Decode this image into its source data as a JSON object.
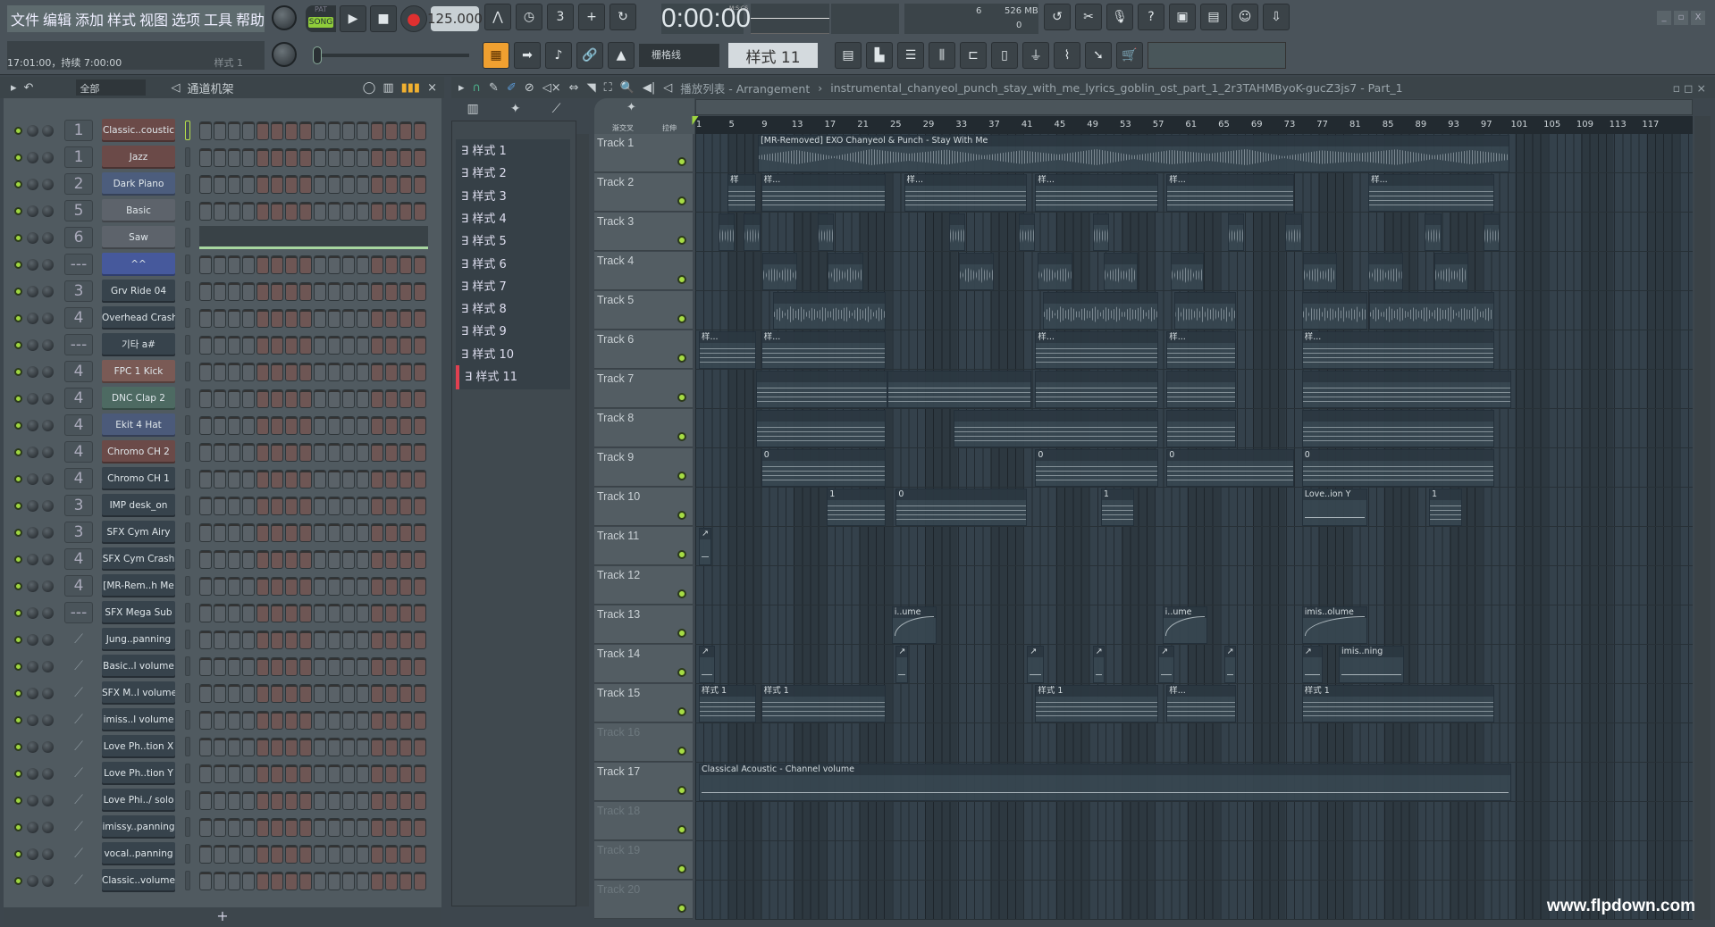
{
  "menu": [
    "文件",
    "编辑",
    "添加",
    "样式",
    "视图",
    "选项",
    "工具",
    "帮助"
  ],
  "hint": {
    "text": "17:01:00，持续 7:00:00",
    "pattern": "样式 1"
  },
  "transport": {
    "pat": "PAT",
    "song": "SONG",
    "tempo": "125.000",
    "time": "0:00:00",
    "time_unit": "M:S:CS",
    "cpu": "6",
    "memory": "526 MB",
    "poly": "0",
    "snap": "栅格线",
    "pattern": "样式 11"
  },
  "colors": {
    "accent": "#f0a030",
    "led": "#a6dc44",
    "record": "#e03030"
  },
  "channel_rack": {
    "filter": "全部",
    "title": "通道机架",
    "add": "+",
    "channels": [
      {
        "name": "Classic..coustic",
        "mixer": "1",
        "color": "#6b4a48"
      },
      {
        "name": "Jazz",
        "mixer": "1",
        "color": "#6b4a48"
      },
      {
        "name": "Dark Piano",
        "mixer": "2",
        "color": "#4c5d7d"
      },
      {
        "name": "Basic",
        "mixer": "5",
        "color": "#5d636b"
      },
      {
        "name": "Saw",
        "mixer": "6",
        "color": "#5d636b",
        "preview": true
      },
      {
        "name": "^^",
        "mixer": "---",
        "color": "#46599c"
      },
      {
        "name": "Grv Ride 04",
        "mixer": "3",
        "color": "#37434c"
      },
      {
        "name": "Overhead Crash",
        "mixer": "4",
        "color": "#37434c"
      },
      {
        "name": "기타 a#",
        "mixer": "---",
        "color": "#37434c"
      },
      {
        "name": "FPC 1 Kick",
        "mixer": "4",
        "color": "#7a5a55"
      },
      {
        "name": "DNC Clap 2",
        "mixer": "4",
        "color": "#4d6a62"
      },
      {
        "name": "Ekit 4 Hat",
        "mixer": "4",
        "color": "#4b5a7a"
      },
      {
        "name": "Chromo CH 2",
        "mixer": "4",
        "color": "#6b4a48"
      },
      {
        "name": "Chromo CH 1",
        "mixer": "4",
        "color": "#37434c"
      },
      {
        "name": "IMP desk_on",
        "mixer": "3",
        "color": "#37434c"
      },
      {
        "name": "SFX Cym Airy",
        "mixer": "3",
        "color": "#37434c"
      },
      {
        "name": "SFX Cym Crash",
        "mixer": "4",
        "color": "#37434c"
      },
      {
        "name": "[MR-Rem..h Me",
        "mixer": "4",
        "color": "#37434c"
      },
      {
        "name": "SFX Mega Sub",
        "mixer": "---",
        "color": "#37434c"
      },
      {
        "name": "Jung..panning",
        "mixer": "",
        "color": "#37434c",
        "auto": true
      },
      {
        "name": "Basic..l volume",
        "mixer": "",
        "color": "#37434c",
        "auto": true
      },
      {
        "name": "SFX M..l volume",
        "mixer": "",
        "color": "#37434c",
        "auto": true
      },
      {
        "name": "imiss..l volume",
        "mixer": "",
        "color": "#37434c",
        "auto": true
      },
      {
        "name": "Love Ph..tion X",
        "mixer": "",
        "color": "#37434c",
        "auto": true
      },
      {
        "name": "Love Ph..tion Y",
        "mixer": "",
        "color": "#37434c",
        "auto": true
      },
      {
        "name": "Love Phi../ solo",
        "mixer": "",
        "color": "#37434c",
        "auto": true
      },
      {
        "name": "imissy..panning",
        "mixer": "",
        "color": "#37434c",
        "auto": true
      },
      {
        "name": "vocal..panning",
        "mixer": "",
        "color": "#37434c",
        "auto": true
      },
      {
        "name": "Classic..volume",
        "mixer": "",
        "color": "#37434c",
        "auto": true
      }
    ]
  },
  "patterns": [
    "样式 1",
    "样式 2",
    "样式 3",
    "样式 4",
    "样式 5",
    "样式 6",
    "样式 7",
    "样式 8",
    "样式 9",
    "样式 10",
    "样式 11"
  ],
  "selected_pattern": "样式 11",
  "playlist": {
    "title": "播放列表 - Arrangement",
    "project": "instrumental_chanyeol_punch_stay_with_me_lyrics_goblin_ost_part_1_2r3TAHMByoK-gucZ3js7 - Part_1",
    "crossfade": "渐交叉",
    "stretch": "拉伸",
    "ruler": [
      1,
      5,
      9,
      13,
      17,
      21,
      25,
      29,
      33,
      37,
      41,
      45,
      49,
      53,
      57,
      61,
      65,
      69,
      73,
      77,
      81,
      85,
      89,
      93,
      97,
      101,
      105,
      109,
      113,
      117
    ],
    "tracks": [
      {
        "name": "Track 1",
        "clips": [
          {
            "type": "audio",
            "start": 8.2,
            "end": 99.8,
            "label": "[MR-Removed] EXO Chanyeol & Punch - Stay With Me"
          }
        ]
      },
      {
        "name": "Track 2",
        "clips": [
          {
            "type": "pattern",
            "start": 4.5,
            "end": 8,
            "label": "样"
          },
          {
            "type": "pattern",
            "start": 8.6,
            "end": 23.8,
            "label": "样..."
          },
          {
            "type": "pattern",
            "start": 26,
            "end": 41,
            "label": "样..."
          },
          {
            "type": "pattern",
            "start": 42,
            "end": 57,
            "label": "样..."
          },
          {
            "type": "pattern",
            "start": 58,
            "end": 73.5,
            "label": "样..."
          },
          {
            "type": "pattern",
            "start": 82.6,
            "end": 98,
            "label": "样..."
          }
        ]
      },
      {
        "name": "Track 3",
        "clips": [
          {
            "type": "audio",
            "start": 3.4,
            "end": 5.4,
            "label": ""
          },
          {
            "type": "audio",
            "start": 6.5,
            "end": 8.5,
            "label": ""
          },
          {
            "type": "audio",
            "start": 15.5,
            "end": 17.5,
            "label": ""
          },
          {
            "type": "audio",
            "start": 31.5,
            "end": 33.5,
            "label": ""
          },
          {
            "type": "audio",
            "start": 40,
            "end": 42,
            "label": ""
          },
          {
            "type": "audio",
            "start": 49,
            "end": 51,
            "label": ""
          },
          {
            "type": "audio",
            "start": 65.5,
            "end": 67.5,
            "label": ""
          },
          {
            "type": "audio",
            "start": 72.5,
            "end": 74.5,
            "label": ""
          },
          {
            "type": "audio",
            "start": 89.5,
            "end": 91.5,
            "label": ""
          },
          {
            "type": "audio",
            "start": 96.6,
            "end": 98.6,
            "label": ""
          }
        ]
      },
      {
        "name": "Track 4",
        "clips": [
          {
            "type": "audio",
            "start": 8.7,
            "end": 13,
            "label": ""
          },
          {
            "type": "audio",
            "start": 16.7,
            "end": 21,
            "label": ""
          },
          {
            "type": "audio",
            "start": 32.7,
            "end": 37,
            "label": ""
          },
          {
            "type": "audio",
            "start": 42.3,
            "end": 46.5,
            "label": ""
          },
          {
            "type": "audio",
            "start": 50.3,
            "end": 54.5,
            "label": ""
          },
          {
            "type": "audio",
            "start": 58.5,
            "end": 62.5,
            "label": ""
          },
          {
            "type": "audio",
            "start": 74.6,
            "end": 78.8,
            "label": ""
          },
          {
            "type": "audio",
            "start": 82.6,
            "end": 86.8,
            "label": ""
          },
          {
            "type": "audio",
            "start": 90.6,
            "end": 94.8,
            "label": ""
          }
        ]
      },
      {
        "name": "Track 5",
        "clips": [
          {
            "type": "audio",
            "start": 10,
            "end": 23.8,
            "label": ""
          },
          {
            "type": "audio",
            "start": 42.9,
            "end": 57,
            "label": ""
          },
          {
            "type": "audio",
            "start": 59,
            "end": 66.5,
            "label": ""
          },
          {
            "type": "audio",
            "start": 74.5,
            "end": 82.5,
            "label": ""
          },
          {
            "type": "audio",
            "start": 82.7,
            "end": 98,
            "label": ""
          }
        ]
      },
      {
        "name": "Track 6",
        "clips": [
          {
            "type": "pattern",
            "start": 1,
            "end": 8,
            "label": "样..."
          },
          {
            "type": "pattern",
            "start": 8.6,
            "end": 23.8,
            "label": "样..."
          },
          {
            "type": "pattern",
            "start": 42,
            "end": 57,
            "label": "样..."
          },
          {
            "type": "pattern",
            "start": 58,
            "end": 66.5,
            "label": "样..."
          },
          {
            "type": "pattern",
            "start": 74.5,
            "end": 98,
            "label": "样..."
          }
        ]
      },
      {
        "name": "Track 7",
        "clips": [
          {
            "type": "pattern",
            "start": 8,
            "end": 24,
            "label": ""
          },
          {
            "type": "pattern",
            "start": 24,
            "end": 41.5,
            "label": ""
          },
          {
            "type": "pattern",
            "start": 42,
            "end": 57,
            "label": ""
          },
          {
            "type": "pattern",
            "start": 58,
            "end": 66.5,
            "label": ""
          },
          {
            "type": "pattern",
            "start": 74.5,
            "end": 100,
            "label": ""
          }
        ]
      },
      {
        "name": "Track 8",
        "clips": [
          {
            "type": "pattern",
            "start": 8,
            "end": 23.8,
            "label": ""
          },
          {
            "type": "pattern",
            "start": 32,
            "end": 57,
            "label": ""
          },
          {
            "type": "pattern",
            "start": 58,
            "end": 66.5,
            "label": ""
          },
          {
            "type": "pattern",
            "start": 74.5,
            "end": 98,
            "label": ""
          }
        ]
      },
      {
        "name": "Track 9",
        "clips": [
          {
            "type": "pattern",
            "start": 8.6,
            "end": 23.8,
            "label": "0"
          },
          {
            "type": "pattern",
            "start": 42,
            "end": 57,
            "label": "0"
          },
          {
            "type": "pattern",
            "start": 58,
            "end": 73.5,
            "label": "0"
          },
          {
            "type": "pattern",
            "start": 74.5,
            "end": 98,
            "label": "0"
          }
        ]
      },
      {
        "name": "Track 10",
        "clips": [
          {
            "type": "pattern",
            "start": 16.6,
            "end": 23.8,
            "label": "1"
          },
          {
            "type": "pattern",
            "start": 25,
            "end": 41,
            "label": "0"
          },
          {
            "type": "pattern",
            "start": 50,
            "end": 54,
            "label": "1"
          },
          {
            "type": "auto",
            "start": 74.5,
            "end": 82.5,
            "label": "Love..ion Y"
          },
          {
            "type": "pattern",
            "start": 90,
            "end": 94,
            "label": "1"
          }
        ]
      },
      {
        "name": "Track 11",
        "clips": [
          {
            "type": "auto",
            "start": 1,
            "end": 2.5,
            "label": "↗"
          }
        ]
      },
      {
        "name": "Track 12",
        "clips": []
      },
      {
        "name": "Track 13",
        "clips": [
          {
            "type": "auto curve",
            "start": 24.5,
            "end": 30,
            "label": "i..ume"
          },
          {
            "type": "auto curve",
            "start": 57.5,
            "end": 63,
            "label": "i..ume"
          },
          {
            "type": "auto curve",
            "start": 74.5,
            "end": 82.5,
            "label": "imis..olume"
          }
        ]
      },
      {
        "name": "Track 14",
        "clips": [
          {
            "type": "auto",
            "start": 1,
            "end": 3,
            "label": "↗"
          },
          {
            "type": "auto",
            "start": 25,
            "end": 26.5,
            "label": "↗"
          },
          {
            "type": "auto",
            "start": 41,
            "end": 43,
            "label": "↗"
          },
          {
            "type": "auto",
            "start": 49,
            "end": 50.5,
            "label": "↗"
          },
          {
            "type": "auto",
            "start": 57,
            "end": 59,
            "label": "↗"
          },
          {
            "type": "auto",
            "start": 65,
            "end": 66.5,
            "label": "↗"
          },
          {
            "type": "auto",
            "start": 74.5,
            "end": 77,
            "label": "↗"
          },
          {
            "type": "auto",
            "start": 79,
            "end": 87,
            "label": "imis..ning"
          }
        ]
      },
      {
        "name": "Track 15",
        "clips": [
          {
            "type": "pattern",
            "start": 1,
            "end": 8,
            "label": "样式 1"
          },
          {
            "type": "pattern",
            "start": 8.6,
            "end": 23.8,
            "label": "样式 1"
          },
          {
            "type": "pattern",
            "start": 42,
            "end": 57,
            "label": "样式 1"
          },
          {
            "type": "pattern",
            "start": 58,
            "end": 66.5,
            "label": "样..."
          },
          {
            "type": "pattern",
            "start": 74.5,
            "end": 98,
            "label": "样式 1"
          }
        ]
      },
      {
        "name": "Track 16",
        "dim": true,
        "clips": []
      },
      {
        "name": "Track 17",
        "clips": [
          {
            "type": "auto",
            "start": 1,
            "end": 100,
            "label": "Classical Acoustic - Channel volume"
          }
        ]
      },
      {
        "name": "Track 18",
        "dim": true,
        "clips": []
      },
      {
        "name": "Track 19",
        "dim": true,
        "clips": []
      },
      {
        "name": "Track 20",
        "dim": true,
        "clips": []
      }
    ]
  },
  "watermark": "www.flpdown.com"
}
